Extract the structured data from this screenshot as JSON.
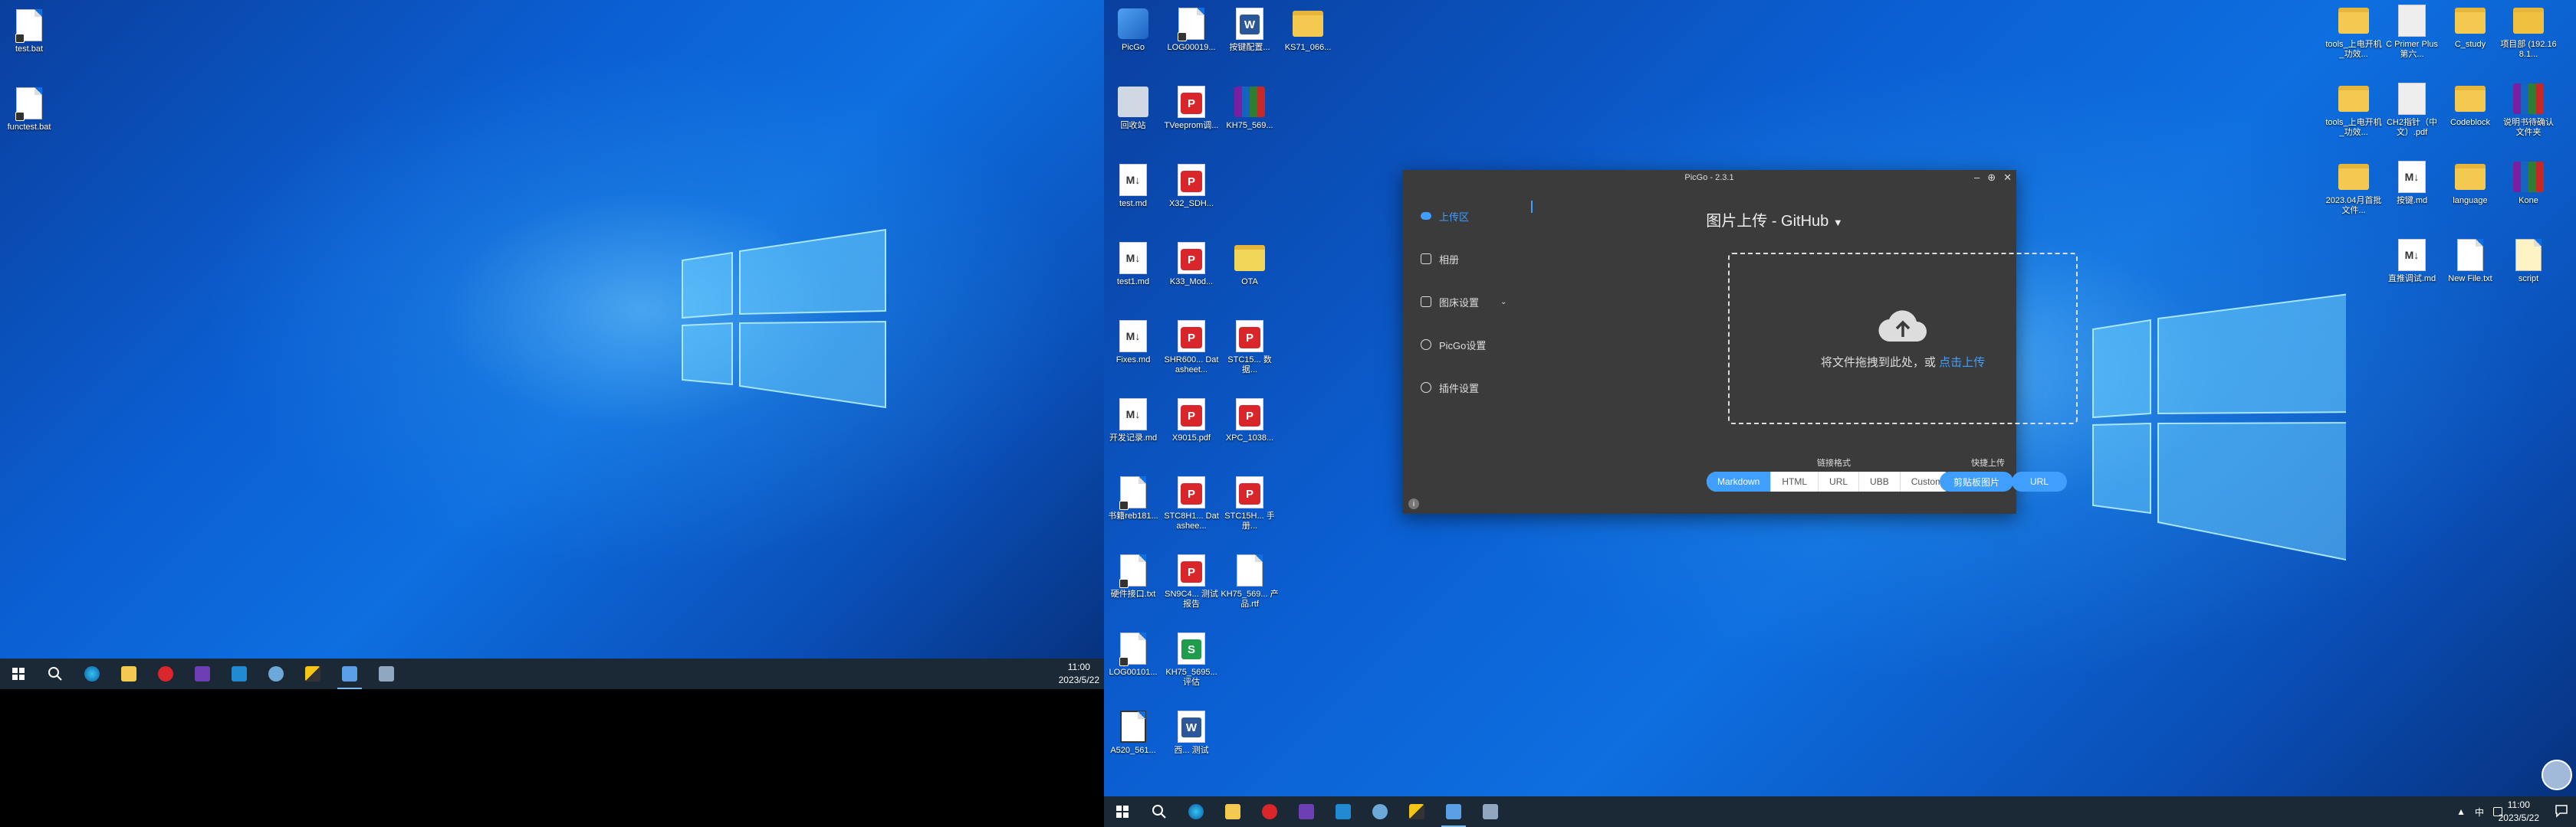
{
  "left_screen": {
    "icons": [
      {
        "label": "test.bat"
      },
      {
        "label": "functest.bat"
      }
    ],
    "clock": {
      "time": "11:00",
      "date": "2023/5/22"
    }
  },
  "right_screen": {
    "icons_col1": [
      {
        "label": "PicGo"
      },
      {
        "label": "回收站"
      },
      {
        "label": "test.md"
      },
      {
        "label": "test1.md"
      },
      {
        "label": "Fixes.md"
      },
      {
        "label": "开发记录.md"
      },
      {
        "label": "书籍reb181..."
      },
      {
        "label": "硬件接口.txt"
      },
      {
        "label": "LOG00101..."
      },
      {
        "label": "A520_561..."
      }
    ],
    "icons_col2": [
      {
        "label": "LOG00019..."
      },
      {
        "label": "TVeeprom调..."
      },
      {
        "label": "X32_SDH..."
      },
      {
        "label": "K33_Mod..."
      },
      {
        "label": "SHR600... Datasheet..."
      },
      {
        "label": "X9015.pdf"
      },
      {
        "label": "STC8H1... Datashee..."
      },
      {
        "label": "SN9C4... 测试报告"
      },
      {
        "label": "KH75_5695... 评估"
      },
      {
        "label": "西... 测试"
      }
    ],
    "icons_col3": [
      {
        "label": "按键配置..."
      },
      {
        "label": "KH75_569..."
      },
      {
        "label": "OTA"
      },
      {
        "label": "STC15... 数据..."
      },
      {
        "label": "XPC_1038..."
      },
      {
        "label": "STC15H... 手册..."
      },
      {
        "label": "KH75_569... 产品.rtf"
      }
    ],
    "icons_col4": [
      {
        "label": "KS71_066..."
      }
    ],
    "icons_right_top": [
      {
        "label": "tools_上电开机_功效..."
      },
      {
        "label": "C Primer Plus 第六..."
      },
      {
        "label": "C_study"
      },
      {
        "label": "项目部 (192.168.1..."
      }
    ],
    "icons_right_row2": [
      {
        "label": "tools_上电开机_功效..."
      },
      {
        "label": "CH2指针（中文）.pdf"
      },
      {
        "label": "Codeblock"
      },
      {
        "label": "说明书待确认文件夹"
      }
    ],
    "icons_right_row3": [
      {
        "label": "2023.04月首批文件..."
      },
      {
        "label": "按键.md"
      },
      {
        "label": "language"
      },
      {
        "label": "Kone"
      }
    ],
    "icons_right_row4": [
      {
        "label": "直推调试.md"
      },
      {
        "label": "New File.txt"
      },
      {
        "label": "script"
      }
    ],
    "clock": {
      "time": "11:00",
      "date": "2023/5/22"
    },
    "tray_ime": "中"
  },
  "picgo": {
    "title": "PicGo - 2.3.1",
    "nav": [
      {
        "label": "上传区"
      },
      {
        "label": "相册"
      },
      {
        "label": "图床设置"
      },
      {
        "label": "PicGo设置"
      },
      {
        "label": "插件设置"
      }
    ],
    "heading": "图片上传 - GitHub",
    "drop_text": "将文件拖拽到此处，或",
    "drop_link": "点击上传",
    "format_label": "链接格式",
    "formats": [
      "Markdown",
      "HTML",
      "URL",
      "UBB",
      "Custom"
    ],
    "selected_format": "Markdown",
    "quick_label": "快捷上传",
    "quick_buttons": [
      "剪贴板图片",
      "URL"
    ]
  },
  "colors": {
    "accent": "#409eff",
    "taskbar": "#1b2836",
    "window_bg": "#3b3b3b"
  }
}
